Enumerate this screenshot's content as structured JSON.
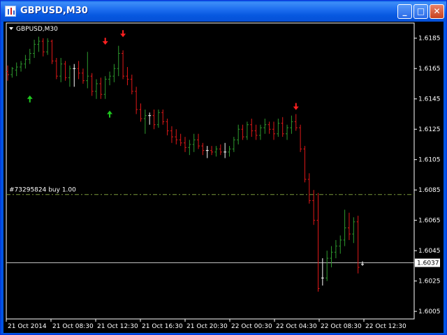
{
  "window": {
    "title": "GBPUSD,M30",
    "buttons": {
      "minimize": "_",
      "maximize": "□",
      "close": "✕"
    }
  },
  "chart_data": {
    "type": "ohlc",
    "title": "GBPUSD,M30",
    "order_label": "#73295824 buy 1.00",
    "order_level": 1.6082,
    "current_price": 1.6037,
    "current_price_label": "1.6037",
    "ylim": [
      1.6,
      1.6195
    ],
    "y_ticks": [
      "1.6185",
      "1.6165",
      "1.6145",
      "1.6125",
      "1.6105",
      "1.6085",
      "1.6065",
      "1.6045",
      "1.6025",
      "1.6005"
    ],
    "x_ticks": [
      "21 Oct 2014",
      "21 Oct 08:30",
      "21 Oct 12:30",
      "21 Oct 16:30",
      "21 Oct 20:30",
      "22 Oct 00:30",
      "22 Oct 04:30",
      "22 Oct 08:30",
      "22 Oct 12:30"
    ],
    "colors": {
      "up": "#2e9a2e",
      "down": "#e01818",
      "doji": "#ffffff",
      "axis": "#ffffff",
      "order_line": "#7a9a3a",
      "arrow_up": "#1ec81e",
      "arrow_down": "#ff2020"
    },
    "bars": [
      [
        1.6163,
        1.6167,
        1.6157,
        1.6161
      ],
      [
        1.6161,
        1.6166,
        1.6159,
        1.6165
      ],
      [
        1.6164,
        1.6169,
        1.616,
        1.6166
      ],
      [
        1.6166,
        1.617,
        1.6163,
        1.6168
      ],
      [
        1.6168,
        1.6174,
        1.6165,
        1.6171
      ],
      [
        1.6171,
        1.6178,
        1.6168,
        1.6175
      ],
      [
        1.6175,
        1.6184,
        1.6172,
        1.6181
      ],
      [
        1.6181,
        1.6186,
        1.6176,
        1.6183
      ],
      [
        1.6183,
        1.6185,
        1.6173,
        1.6176
      ],
      [
        1.6176,
        1.6185,
        1.6174,
        1.6183
      ],
      [
        1.6183,
        1.6184,
        1.6168,
        1.617
      ],
      [
        1.617,
        1.6172,
        1.6158,
        1.616
      ],
      [
        1.616,
        1.6172,
        1.6156,
        1.6168
      ],
      [
        1.6168,
        1.617,
        1.6157,
        1.6159
      ],
      [
        1.6159,
        1.6167,
        1.6153,
        1.6165
      ],
      [
        1.6165,
        1.6168,
        1.6153,
        1.6165
      ],
      [
        1.6165,
        1.617,
        1.6158,
        1.6162
      ],
      [
        1.6162,
        1.6165,
        1.6155,
        1.6157
      ],
      [
        1.6157,
        1.6176,
        1.6152,
        1.616
      ],
      [
        1.616,
        1.6162,
        1.6147,
        1.615
      ],
      [
        1.615,
        1.6158,
        1.6145,
        1.6155
      ],
      [
        1.6155,
        1.6159,
        1.6145,
        1.6148
      ],
      [
        1.6148,
        1.616,
        1.6145,
        1.6158
      ],
      [
        1.6158,
        1.6163,
        1.6154,
        1.616
      ],
      [
        1.616,
        1.6168,
        1.6156,
        1.6165
      ],
      [
        1.6165,
        1.618,
        1.616,
        1.6175
      ],
      [
        1.6175,
        1.6177,
        1.6158,
        1.616
      ],
      [
        1.616,
        1.6166,
        1.6154,
        1.6158
      ],
      [
        1.6158,
        1.6161,
        1.6148,
        1.615
      ],
      [
        1.615,
        1.6153,
        1.6135,
        1.6138
      ],
      [
        1.6138,
        1.6142,
        1.613,
        1.6132
      ],
      [
        1.6132,
        1.6138,
        1.6122,
        1.6134
      ],
      [
        1.6134,
        1.6136,
        1.6128,
        1.6134
      ],
      [
        1.6134,
        1.6138,
        1.6125,
        1.6128
      ],
      [
        1.6128,
        1.6138,
        1.6126,
        1.6136
      ],
      [
        1.6136,
        1.6138,
        1.6128,
        1.613
      ],
      [
        1.613,
        1.6132,
        1.6121,
        1.6124
      ],
      [
        1.6124,
        1.6127,
        1.6116,
        1.612
      ],
      [
        1.612,
        1.6125,
        1.6115,
        1.6118
      ],
      [
        1.6118,
        1.6122,
        1.6114,
        1.6116
      ],
      [
        1.6116,
        1.612,
        1.611,
        1.6113
      ],
      [
        1.6113,
        1.6118,
        1.6108,
        1.6115
      ],
      [
        1.6115,
        1.6122,
        1.611,
        1.6118
      ],
      [
        1.6118,
        1.6122,
        1.6112,
        1.6114
      ],
      [
        1.6114,
        1.6116,
        1.6108,
        1.6111
      ],
      [
        1.6111,
        1.6114,
        1.6106,
        1.6111
      ],
      [
        1.6111,
        1.6114,
        1.6108,
        1.611
      ],
      [
        1.611,
        1.6114,
        1.6107,
        1.6112
      ],
      [
        1.6112,
        1.6115,
        1.6108,
        1.611
      ],
      [
        1.611,
        1.6116,
        1.6106,
        1.611
      ],
      [
        1.611,
        1.6114,
        1.6107,
        1.6112
      ],
      [
        1.6112,
        1.612,
        1.611,
        1.6118
      ],
      [
        1.6118,
        1.6128,
        1.6115,
        1.6125
      ],
      [
        1.6125,
        1.6128,
        1.6118,
        1.612
      ],
      [
        1.612,
        1.613,
        1.6118,
        1.6128
      ],
      [
        1.6128,
        1.6132,
        1.612,
        1.6124
      ],
      [
        1.6124,
        1.6128,
        1.6118,
        1.6121
      ],
      [
        1.6121,
        1.6128,
        1.6118,
        1.6126
      ],
      [
        1.6126,
        1.6132,
        1.6122,
        1.6128
      ],
      [
        1.6128,
        1.613,
        1.6122,
        1.6125
      ],
      [
        1.6125,
        1.613,
        1.6118,
        1.6122
      ],
      [
        1.6122,
        1.6132,
        1.612,
        1.6129
      ],
      [
        1.6129,
        1.6133,
        1.612,
        1.6122
      ],
      [
        1.6122,
        1.6128,
        1.6118,
        1.6126
      ],
      [
        1.6126,
        1.6134,
        1.6122,
        1.613
      ],
      [
        1.613,
        1.6135,
        1.6124,
        1.6126
      ],
      [
        1.6126,
        1.6128,
        1.611,
        1.6112
      ],
      [
        1.6112,
        1.6114,
        1.609,
        1.6092
      ],
      [
        1.6092,
        1.6096,
        1.6076,
        1.6078
      ],
      [
        1.6078,
        1.6085,
        1.6062,
        1.6065
      ],
      [
        1.6065,
        1.6083,
        1.6018,
        1.602
      ],
      [
        1.6027,
        1.604,
        1.6022,
        1.6027
      ],
      [
        1.6027,
        1.6045,
        1.6025,
        1.604
      ],
      [
        1.604,
        1.6048,
        1.6034,
        1.6044
      ],
      [
        1.6044,
        1.6052,
        1.604,
        1.6048
      ],
      [
        1.6048,
        1.6055,
        1.6043,
        1.6052
      ],
      [
        1.6052,
        1.6072,
        1.6048,
        1.606
      ],
      [
        1.606,
        1.607,
        1.6052,
        1.6056
      ],
      [
        1.6056,
        1.6067,
        1.605,
        1.6064
      ],
      [
        1.6064,
        1.6068,
        1.603,
        1.6034
      ],
      [
        1.6036,
        1.6038,
        1.6035,
        1.6036
      ]
    ],
    "arrows": [
      {
        "type": "up",
        "bar": 5,
        "price": 1.6145
      },
      {
        "type": "down",
        "bar": 22,
        "price": 1.6183
      },
      {
        "type": "up",
        "bar": 23,
        "price": 1.6135
      },
      {
        "type": "down",
        "bar": 26,
        "price": 1.6188
      },
      {
        "type": "down",
        "bar": 65,
        "price": 1.614
      }
    ]
  }
}
